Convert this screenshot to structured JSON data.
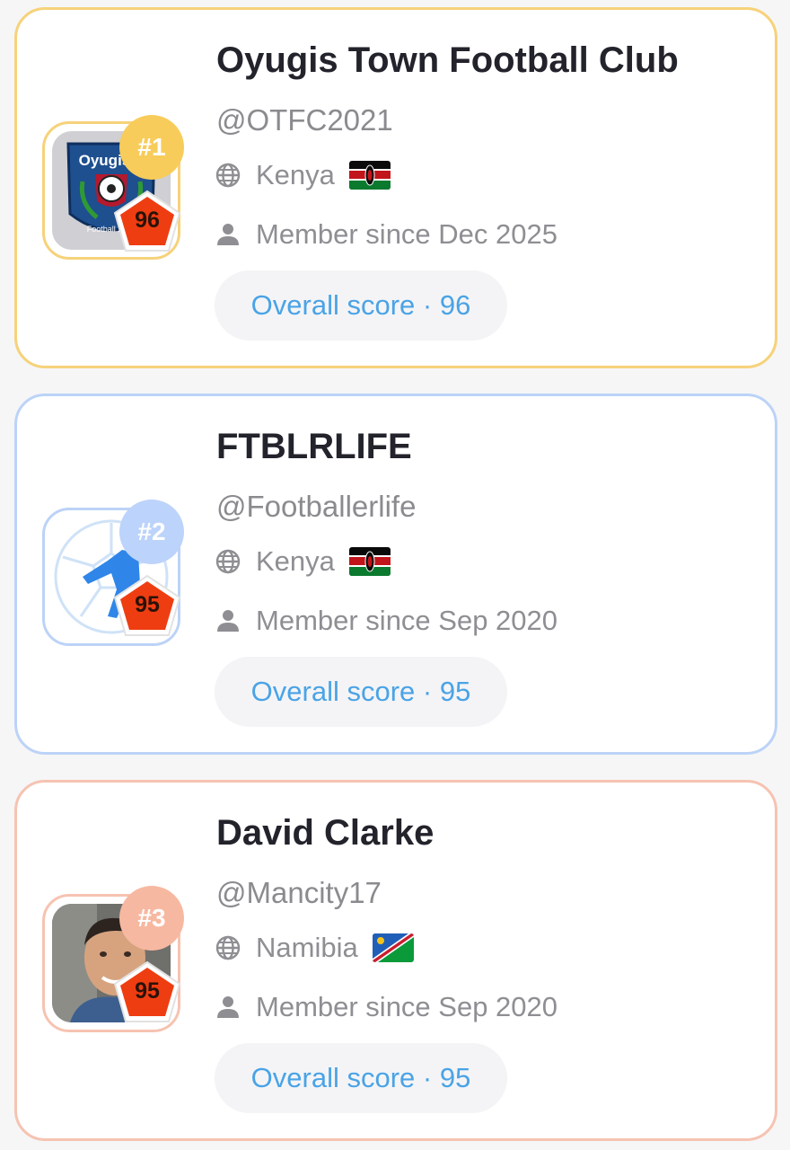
{
  "leaderboard": [
    {
      "rank_label": "#1",
      "score": "96",
      "name": "Oyugis Town Football Club",
      "handle": "@OTFC2021",
      "country": "Kenya",
      "flag": "kenya-flag",
      "member_since": "Member since Dec 2025",
      "overall_score": "Overall score · 96",
      "accent_color": "#f6d27a",
      "rank_color": "#f8cc5a",
      "avatar_icon": "club-crest-icon"
    },
    {
      "rank_label": "#2",
      "score": "95",
      "name": "FTBLRLIFE",
      "handle": "@Footballerlife",
      "country": "Kenya",
      "flag": "kenya-flag",
      "member_since": "Member since Sep 2020",
      "overall_score": "Overall score · 95",
      "accent_color": "#bcd3f7",
      "rank_color": "#bcd3fb",
      "avatar_icon": "footballer-silhouette-icon"
    },
    {
      "rank_label": "#3",
      "score": "95",
      "name": "David Clarke",
      "handle": "@Mancity17",
      "country": "Namibia",
      "flag": "namibia-flag",
      "member_since": "Member since Sep 2020",
      "overall_score": "Overall score · 95",
      "accent_color": "#f6c3b1",
      "rank_color": "#f7b8a1",
      "avatar_icon": "profile-photo"
    }
  ],
  "colors": {
    "score_badge": "#ef3d12",
    "score_pill_text": "#4aa3e6",
    "name_text": "#22232b",
    "muted_text": "#8b8b8f"
  },
  "icons": {
    "country": "globe-icon",
    "member": "person-icon"
  }
}
